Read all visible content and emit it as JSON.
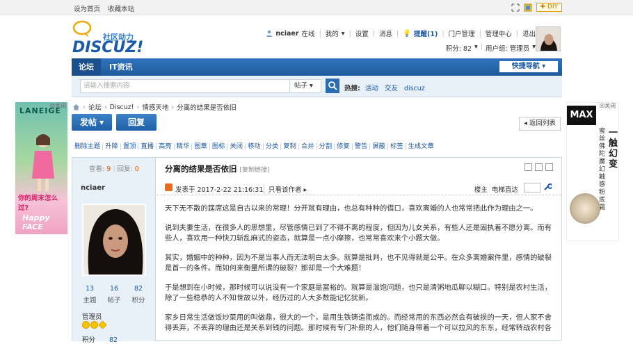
{
  "topbar": {
    "links": [
      "设为首页",
      "收藏本站"
    ],
    "diy": "DIY"
  },
  "header": {
    "logo_cn": "社区动力",
    "logo_en": "DISCUZ!",
    "username": "nciaer",
    "online": "在线",
    "links": [
      "我的",
      "设置",
      "消息"
    ],
    "remind": "提醒(1)",
    "links2": [
      "门户管理",
      "管理中心",
      "退出"
    ],
    "points": "积分: 82",
    "usergroup": "用户组: 管理员"
  },
  "nav": {
    "tabs": [
      "论坛",
      "IT资讯"
    ],
    "quicknav": "快捷导航"
  },
  "search": {
    "placeholder": "请输入搜索内容",
    "type": "帖子",
    "hot_label": "热搜:",
    "hot": [
      "活动",
      "交友",
      "discuz"
    ]
  },
  "ads": {
    "left_brand": "LANEIGE",
    "left_slogan": "你的周末怎么过?",
    "left_tag": "Happy FACE",
    "right_brand": "MAX",
    "right_text": "蜜丝佛陀魔幻触感粉底霜",
    "right_big": "一触幻变",
    "close": "关闭"
  },
  "breadcrumb": [
    "论坛",
    "Discuz!",
    "情感天地",
    "分离的结果是否依旧"
  ],
  "buttons": {
    "post": "发帖",
    "reply": "回复",
    "back": "返回列表"
  },
  "mod_actions": [
    "删除主题",
    "升降",
    "置顶",
    "直播",
    "高亮",
    "精华",
    "图章",
    "图标",
    "关闭",
    "移动",
    "分类",
    "复制",
    "合并",
    "分割",
    "修复",
    "警告",
    "屏蔽",
    "标签",
    "生成文章"
  ],
  "post": {
    "views_label": "查看:",
    "views": "9",
    "replies_label": "回复:",
    "replies": "0",
    "author": "nciaer",
    "title": "分离的结果是否依旧",
    "copy_link": "[复制链接]",
    "posted": "发表于 2017-2-22 21:16:31",
    "only_author": "只看该作者",
    "floor": "楼主",
    "goto": "电梯直达",
    "stats": [
      {
        "value": "13",
        "label": "主题"
      },
      {
        "value": "16",
        "label": "帖子"
      },
      {
        "value": "82",
        "label": "积分"
      }
    ],
    "role": "管理员",
    "points_label": "积分",
    "points": "82",
    "paragraphs": [
      "天下无不散的筵席这是自古以来的常理！分开就有理由，也总有种种的借口，喜欢离婚的人也常常把此作为理由之一。",
      "说到夫妻生活，在很多人的思想里，尽管感情已到了不得不离的程度，但因为儿女关系，有些人还是固执着不愿分离。而有些人，喜欢用一种快刀斩乱麻式的姿态，就算是一点小摩擦，也常常喜欢来个小题大做。",
      "其实，婚姻中的种种，因为不是当事人而无法明白太多。就算是批判，也不见得就是公平。在众多离婚案件里，感情的破裂是首一的条件。而如何来衡量所谓的破裂？那却是一个大难题！",
      "于是想到在小时候，那时候可以说没有一个家庭是富裕的。就算是温饱问题，也只是清粥地瓜聊以糊口。特别是农村生活，除了一些稳恭的人不知世故以外，经历过的人大多数能记忆犹新。",
      "家乡日常生活做饭炒菜用的叫做鼎，很大的一个，是用生铁铸造而成的。而经常用的东西必然会有破损的一天，但人家不舍得丢弃，不丢弃的理由还是关系到钱的问题。那时候有专门补鼎的人，他们随身带着一个可以拉风的东东，经常转战农村各"
    ]
  }
}
